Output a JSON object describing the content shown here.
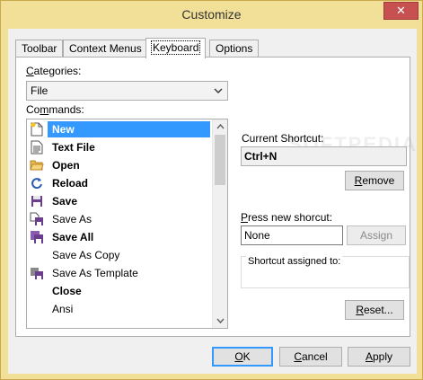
{
  "window": {
    "title": "Customize",
    "close_glyph": "✕"
  },
  "tabs": [
    {
      "label": "Toolbar"
    },
    {
      "label": "Context Menus"
    },
    {
      "label": "Keyboard"
    },
    {
      "label": "Options"
    }
  ],
  "keyboard": {
    "categories_label": "Categories:",
    "categories_accel": "C",
    "categories_rest": "ategories:",
    "categories_value": "File",
    "commands_accel": "m",
    "commands_pre": "Co",
    "commands_post": "mands:",
    "commands": [
      {
        "label": "New",
        "bold": true,
        "icon": "new-document-icon",
        "selected": true
      },
      {
        "label": "Text File",
        "bold": true,
        "icon": "text-file-icon"
      },
      {
        "label": "Open",
        "bold": true,
        "icon": "folder-open-icon"
      },
      {
        "label": "Reload",
        "bold": true,
        "icon": "reload-icon"
      },
      {
        "label": "Save",
        "bold": true,
        "icon": "save-icon"
      },
      {
        "label": "Save As",
        "bold": false,
        "icon": "save-as-icon"
      },
      {
        "label": "Save All",
        "bold": true,
        "icon": "save-all-icon"
      },
      {
        "label": "Save As Copy",
        "bold": false,
        "icon": ""
      },
      {
        "label": "Save As Template",
        "bold": false,
        "icon": "save-template-icon"
      },
      {
        "label": "Close",
        "bold": true,
        "icon": ""
      },
      {
        "label": "Ansi",
        "bold": false,
        "icon": ""
      }
    ],
    "current_shortcut_label": "Current Shortcut:",
    "current_shortcut_value": "Ctrl+N",
    "remove_pre": "",
    "remove_accel": "R",
    "remove_post": "emove",
    "press_new_pre": "",
    "press_new_accel": "P",
    "press_new_post": "ress new shorcut:",
    "new_shortcut_value": "None",
    "assign_label": "Assign",
    "assigned_to_label": "Shortcut assigned to:",
    "reset_accel": "R",
    "reset_post": "eset..."
  },
  "footer": {
    "ok_accel": "O",
    "ok_post": "K",
    "cancel_accel": "C",
    "cancel_post": "ancel",
    "apply_accel": "A",
    "apply_post": "pply"
  },
  "watermark": "SOFTPEDIA",
  "colors": {
    "selection": "#3399ff",
    "frame": "#f3e098",
    "close": "#c75050"
  }
}
